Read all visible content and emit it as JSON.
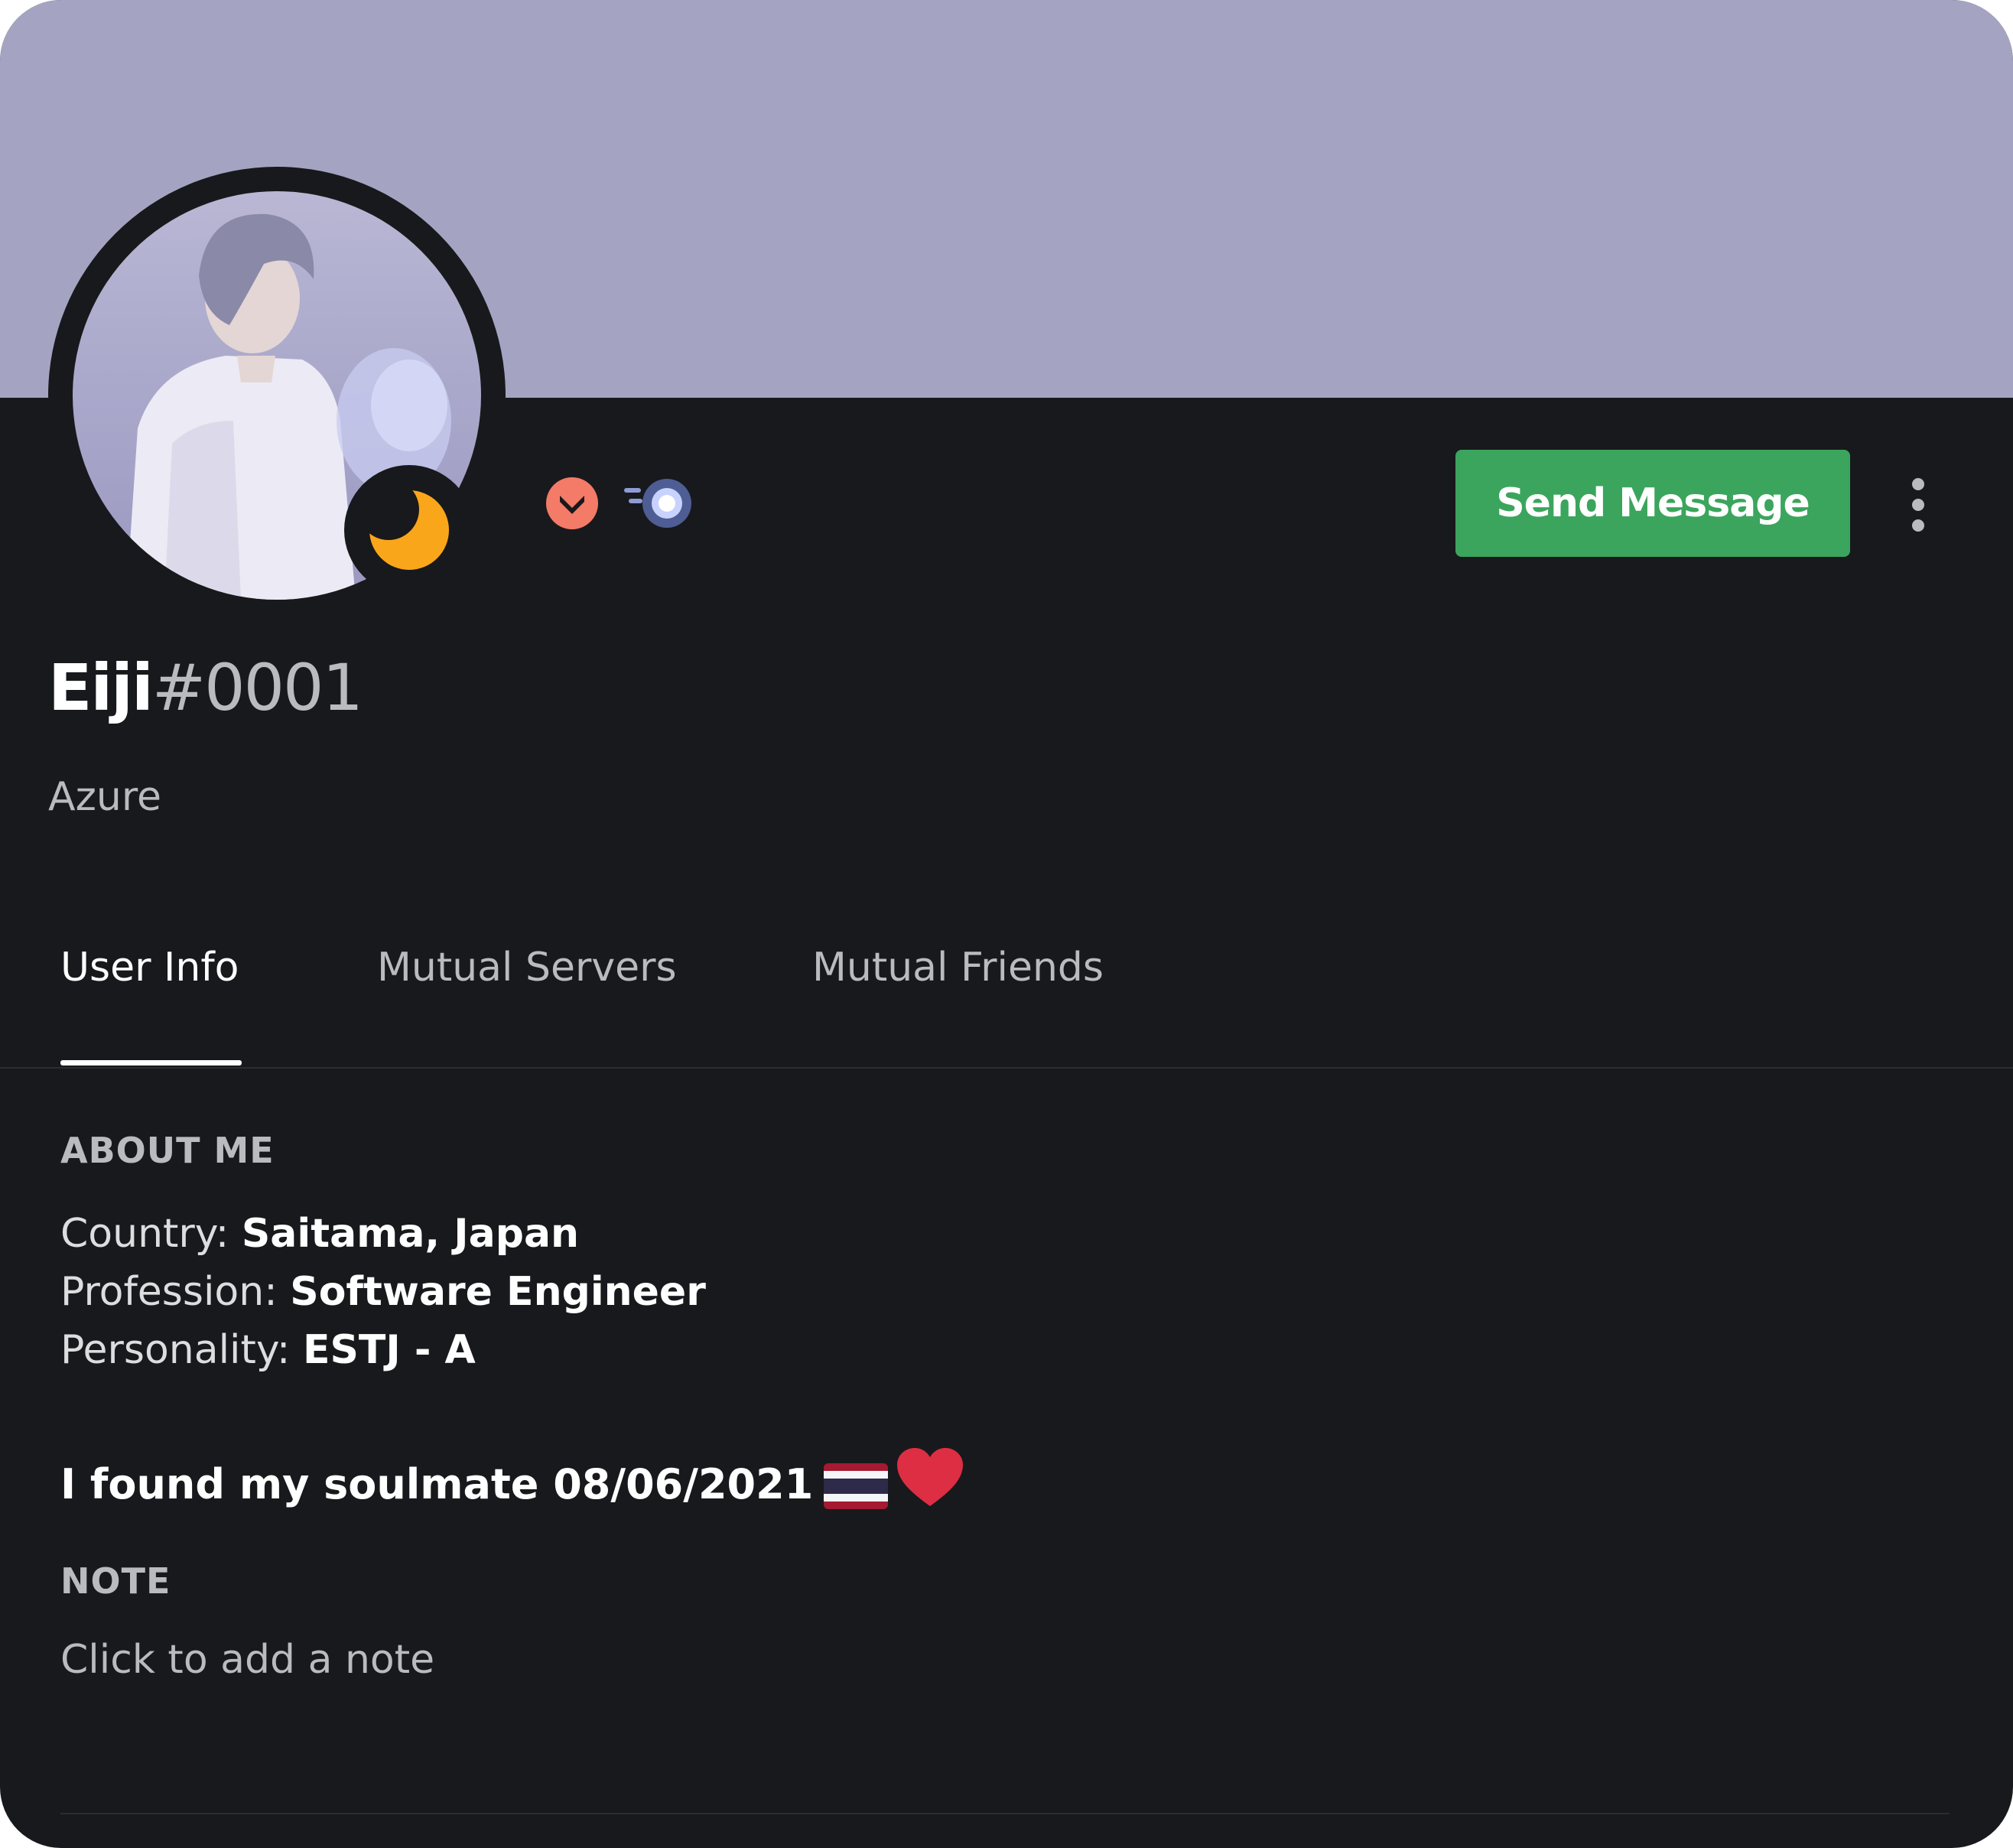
{
  "profile": {
    "banner_color": "#a4a4c2",
    "username": "Eiji",
    "discriminator": "#0001",
    "custom_status": "Azure",
    "status": "idle",
    "status_color": "#faa61a",
    "badges": [
      {
        "name": "hypesquad-bravery-badge",
        "color": "#f47b67"
      },
      {
        "name": "nitro-boost-badge",
        "color": "#c7d2fe"
      }
    ]
  },
  "actions": {
    "send_message_label": "Send Message",
    "send_message_color": "#3ba55d",
    "more_icon": "more-vertical-icon"
  },
  "tabs": [
    {
      "label": "User Info",
      "active": true
    },
    {
      "label": "Mutual Servers",
      "active": false
    },
    {
      "label": "Mutual Friends",
      "active": false
    }
  ],
  "about_me": {
    "title": "ABOUT ME",
    "lines": [
      {
        "label": "Country: ",
        "value": "Saitama, Japan"
      },
      {
        "label": "Profession: ",
        "value": "Software Engineer"
      },
      {
        "label": "Personality: ",
        "value": "ESTJ - A"
      }
    ],
    "highlight": "I found my soulmate 08/06/2021",
    "highlight_emojis": [
      "thailand-flag-icon",
      "red-heart-icon"
    ]
  },
  "note": {
    "title": "NOTE",
    "placeholder": "Click to add a note"
  }
}
